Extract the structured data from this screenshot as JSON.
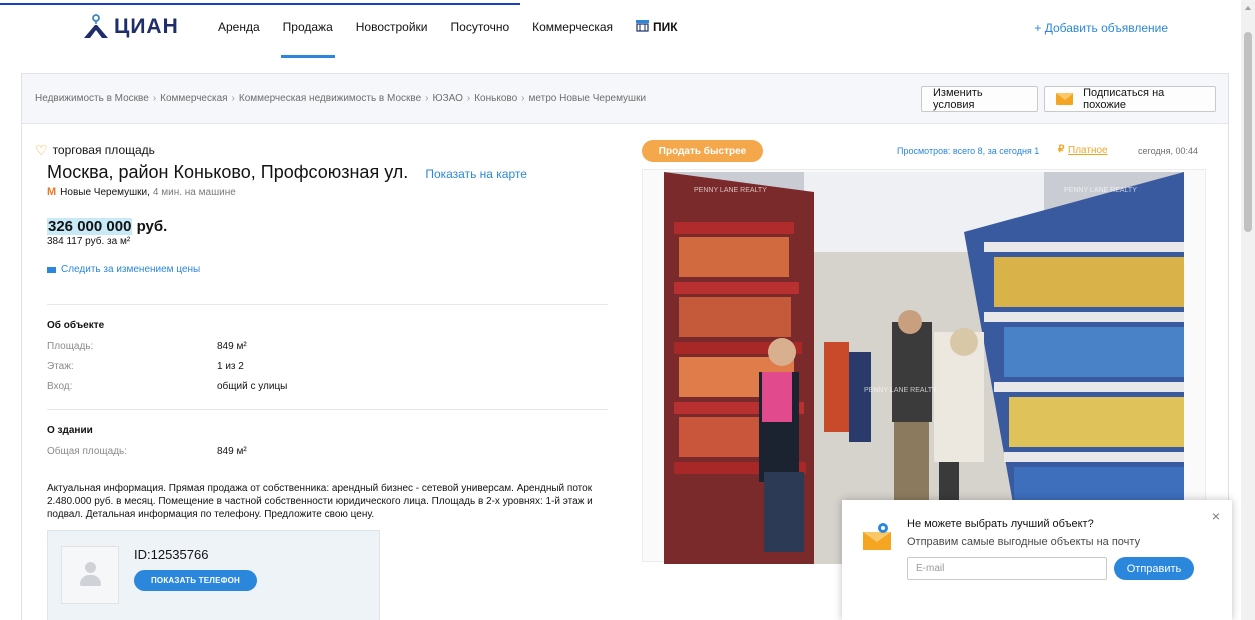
{
  "header": {
    "logo": "ЦИАН",
    "nav": [
      {
        "label": "Аренда",
        "active": false
      },
      {
        "label": "Продажа",
        "active": true
      },
      {
        "label": "Новостройки",
        "active": false
      },
      {
        "label": "Посуточно",
        "active": false
      },
      {
        "label": "Коммерческая",
        "active": false
      },
      {
        "label": "ПИК",
        "active": false
      }
    ],
    "add_ad": "+ Добавить объявление"
  },
  "breadcrumbs": [
    "Недвижимость в Москве",
    "Коммерческая",
    "Коммерческая недвижимость в Москве",
    "ЮЗАО",
    "Коньково",
    "метро Новые Черемушки"
  ],
  "actions": {
    "change_conditions": "Изменить условия",
    "subscribe_similar": "Подписаться на похожие"
  },
  "listing": {
    "type": "торговая площадь",
    "address": "Москва, район Коньково, Профсоюзная ул.",
    "show_on_map": "Показать на карте",
    "metro_station": "Новые Черемушки,",
    "metro_time": "4 мин. на машине",
    "price_value": "326 000 000",
    "price_currency": "руб.",
    "price_per_m2": "384 117 руб. за м²",
    "watch_price": "Следить за изменением цены"
  },
  "about_object": {
    "title": "Об объекте",
    "rows": [
      {
        "label": "Площадь:",
        "value": "849 м²"
      },
      {
        "label": "Этаж:",
        "value": "1 из 2"
      },
      {
        "label": "Вход:",
        "value": "общий с улицы"
      }
    ]
  },
  "about_building": {
    "title": "О здании",
    "rows": [
      {
        "label": "Общая площадь:",
        "value": "849 м²"
      }
    ]
  },
  "description": "Актуальная информация. Прямая продажа от собственника: арендный бизнес - сетевой универсам. Арендный поток 2.480.000 руб. в месяц. Помещение в частной собственности юридического лица. Площадь в 2-х уровнях: 1-й этаж и подвал. Детальная информация по телефону. Предложите свою цену.",
  "agent": {
    "id": "ID:12535766",
    "show_phone": "ПОКАЗАТЬ ТЕЛЕФОН"
  },
  "photo_panel": {
    "sell_faster": "Продать быстрее",
    "views": "Просмотров: всего 8, за сегодня 1",
    "paid": "Платное",
    "date": "сегодня, 00:44",
    "watermark": "PENNY LANE REALTY"
  },
  "popup": {
    "title": "Не можете выбрать лучший объект?",
    "subtitle": "Отправим самые выгодные объекты на почту",
    "email_placeholder": "E-mail",
    "send": "Отправить"
  },
  "colors": {
    "accent_blue": "#2b87db",
    "accent_orange": "#f4a623",
    "price_highlight": "#c7e9f8"
  }
}
